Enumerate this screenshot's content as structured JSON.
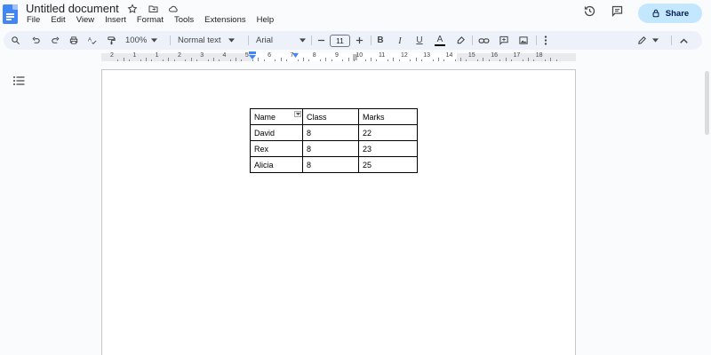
{
  "app": {
    "doc_title": "Untitled document",
    "menu": [
      "File",
      "Edit",
      "View",
      "Insert",
      "Format",
      "Tools",
      "Extensions",
      "Help"
    ],
    "share_label": "Share"
  },
  "toolbar": {
    "zoom": "100%",
    "style": "Normal text",
    "font": "Arial",
    "font_size": "11"
  },
  "ruler": {
    "numbers": [
      "2",
      "1",
      "1",
      "2",
      "3",
      "4",
      "5",
      "6",
      "7",
      "8",
      "9",
      "10",
      "11",
      "12",
      "13",
      "14",
      "15",
      "16",
      "17",
      "18"
    ]
  },
  "table": {
    "header": [
      "Name",
      "Class",
      "Marks"
    ],
    "rows": [
      [
        "David",
        "8",
        "22"
      ],
      [
        "Rex",
        "8",
        "23"
      ],
      [
        "Alicia",
        "8",
        "25"
      ]
    ]
  },
  "colors": {
    "accent": "#4285f4",
    "share_bg": "#c2e7ff",
    "toolbar_bg": "#edf2fa"
  }
}
